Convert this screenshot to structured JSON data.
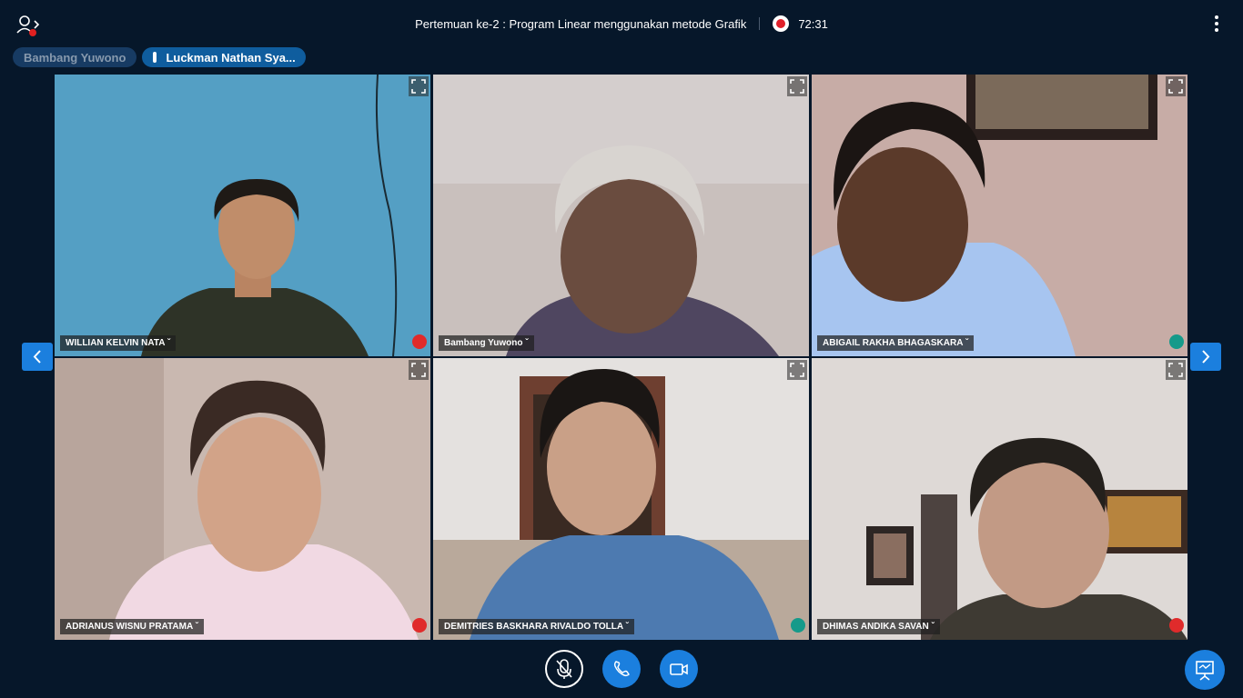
{
  "header": {
    "meeting_title": "Pertemuan ke-2 : Program Linear menggunakan metode Grafik",
    "recording_time": "72:31",
    "icons": {
      "users": "users-toggle-icon",
      "record": "recording-indicator-icon",
      "options": "more-options-icon"
    }
  },
  "talking_indicators": [
    {
      "name": "Bambang Yuwono",
      "speaking": false
    },
    {
      "name": "Luckman Nathan Sya...",
      "speaking": true
    }
  ],
  "participants": [
    {
      "name": "WILLIAN KELVIN NATA",
      "audio": "muted"
    },
    {
      "name": "Bambang Yuwono",
      "audio": "none"
    },
    {
      "name": "ABIGAIL RAKHA BHAGASKARA",
      "audio": "listen-only"
    },
    {
      "name": "ADRIANUS WISNU PRATAMA",
      "audio": "muted"
    },
    {
      "name": "DEMITRIES BASKHARA RIVALDO TOLLA",
      "audio": "listen-only"
    },
    {
      "name": "DHIMAS ANDIKA SAVAN",
      "audio": "muted"
    }
  ],
  "actions": {
    "mute": "unmute-microphone-icon",
    "audio": "phone-audio-icon",
    "video": "video-camera-icon",
    "presentation": "presentation-icon"
  },
  "colors": {
    "background": "#06172a",
    "accent": "#1b7fde",
    "muted": "#e02b2b",
    "listen_only": "#159a8a"
  }
}
